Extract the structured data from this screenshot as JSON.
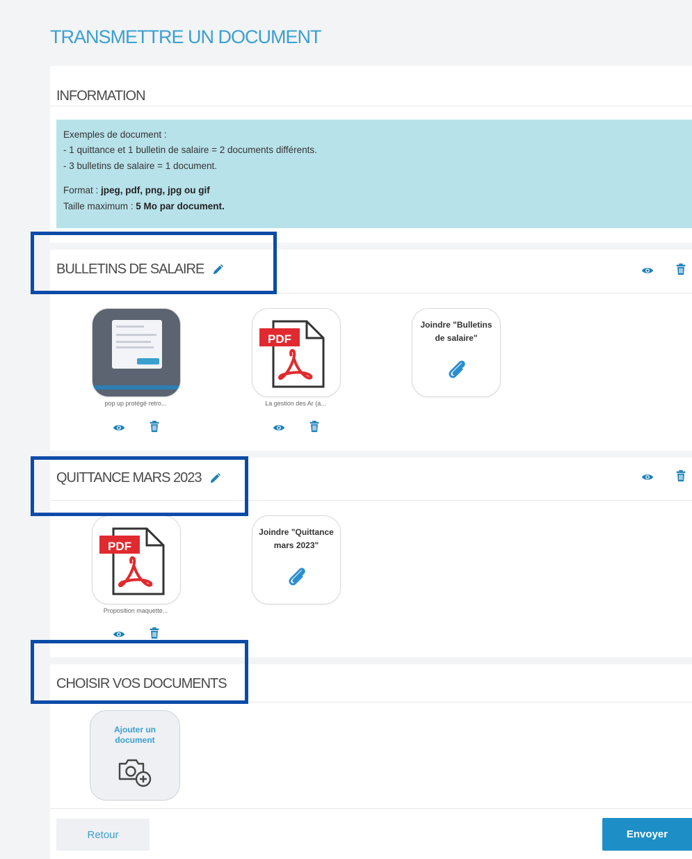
{
  "page": {
    "title": "TRANSMETTRE UN DOCUMENT"
  },
  "information": {
    "title": "INFORMATION",
    "examples_heading": "Exemples de document :",
    "example_1": "- 1 quittance et 1 bulletin de salaire = 2 documents différents.",
    "example_2": "- 3 bulletins de salaire = 1 document.",
    "format_label": "Format : ",
    "format_value": "jpeg, pdf, png, jpg ou gif",
    "size_label": "Taille maximum : ",
    "size_value": "5 Mo par document."
  },
  "groups": [
    {
      "title": "BULLETINS DE SALAIRE",
      "files": [
        {
          "name": "pop up protégé retro...",
          "kind": "image"
        },
        {
          "name": "La gestion des Ar (a...",
          "kind": "pdf",
          "badge": "PDF"
        }
      ],
      "join_label": "Joindre \"Bulletins de salaire\""
    },
    {
      "title": "QUITTANCE MARS 2023",
      "files": [
        {
          "name": "Proposition maquette...",
          "kind": "pdf",
          "badge": "PDF"
        }
      ],
      "join_label": "Joindre \"Quittance mars 2023\""
    }
  ],
  "choose": {
    "title": "CHOISIR VOS DOCUMENTS",
    "add_label": "Ajouter un document"
  },
  "actions": {
    "back_label": "Retour",
    "send_label": "Envoyer"
  },
  "icons": {
    "edit": "pencil-icon",
    "view": "eye-icon",
    "delete": "trash-icon",
    "attach": "paperclip-icon",
    "add_photo": "camera-plus-icon",
    "pdf": "pdf-file-icon"
  },
  "colors": {
    "accent": "#3aa0cf",
    "button_primary": "#1d8fc6",
    "info_bg": "#b8e2ea",
    "pdf_red": "#e02a2f",
    "highlight": "#0b4ba8"
  }
}
